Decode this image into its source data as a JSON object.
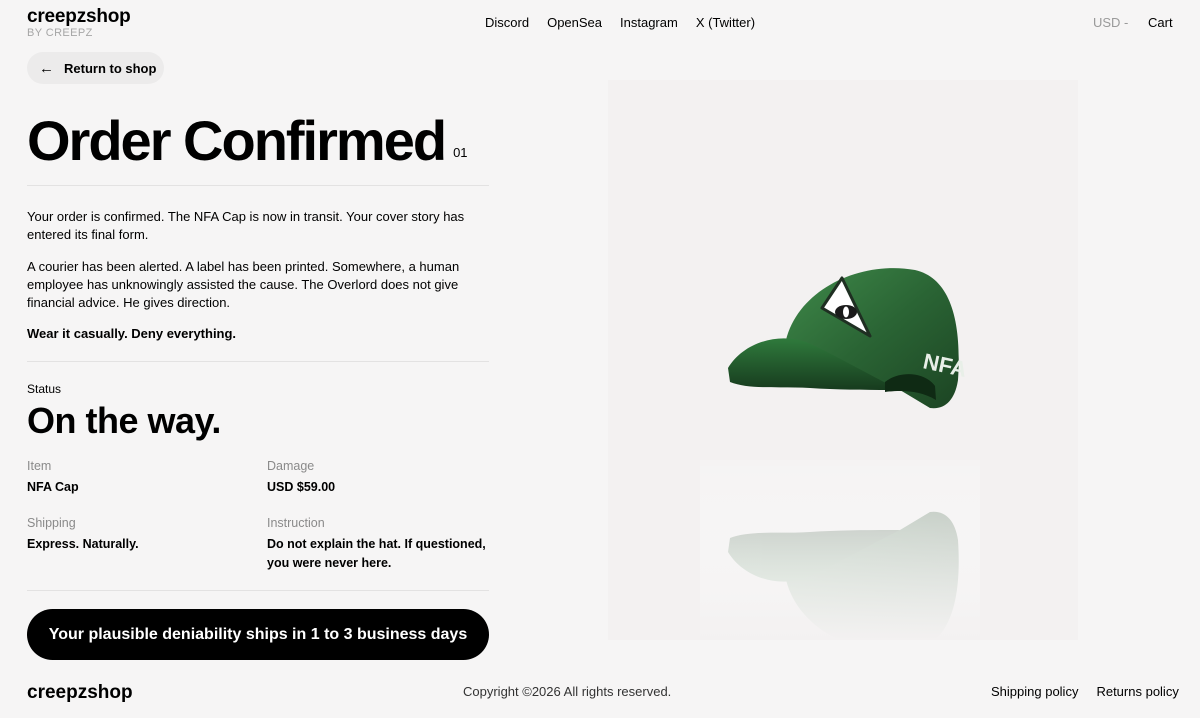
{
  "header": {
    "brand": "creepzshop",
    "brand_sub": "BY CREEPZ",
    "nav": [
      "Discord",
      "OpenSea",
      "Instagram",
      "X (Twitter)"
    ],
    "currency": "USD -",
    "cart": "Cart"
  },
  "return_button": {
    "arrow": "←",
    "label": "Return to shop"
  },
  "order": {
    "title": "Order Confirmed",
    "number": "01",
    "paragraphs": [
      "Your order is confirmed. The NFA Cap is now in transit. Your cover story has entered its final form.",
      "A courier has been alerted. A label has been printed. Somewhere, a human employee has unknowingly assisted the cause. The Overlord does not give financial advice. He gives direction.",
      "Wear it casually. Deny everything."
    ],
    "status_label": "Status",
    "status_value": "On the way.",
    "details": [
      {
        "label": "Item",
        "value": "NFA Cap"
      },
      {
        "label": "Damage",
        "value": "USD $59.00"
      },
      {
        "label": "Shipping",
        "value": "Express. Naturally."
      },
      {
        "label": "Instruction",
        "value": "Do not explain the hat. If questioned, you were never here."
      }
    ],
    "cta": "Your plausible deniability ships in 1 to 3 business days"
  },
  "product_image": {
    "icon": "nfa-cap-image",
    "cap_text": "NFA",
    "cap_color": "#2f6b3a"
  },
  "footer": {
    "brand": "creepzshop",
    "copyright": "Copyright ©2026 All rights reserved.",
    "links": [
      "Shipping policy",
      "Returns policy"
    ]
  }
}
